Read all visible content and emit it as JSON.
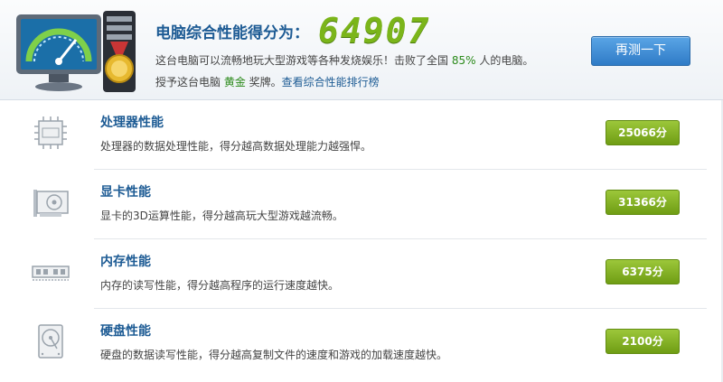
{
  "header": {
    "score_label": "电脑综合性能得分为：",
    "score_value": "64907",
    "desc_part1": "这台电脑可以流畅地玩大型游戏等各种发烧娱乐！击败了全国 ",
    "beat_percent": "85%",
    "desc_part2": " 人的电脑。",
    "award_part1": "授予这台电脑 ",
    "medal": "黄金",
    "award_part2": " 奖牌。",
    "rank_link": "查看综合性能排行榜",
    "retest_label": "再测一下",
    "icons": [
      "performance-meter-monitor-icon",
      "gold-medal-pc-tower-icon"
    ]
  },
  "components": [
    {
      "title": "处理器性能",
      "desc": "处理器的数据处理性能，得分越高数据处理能力越强悍。",
      "score": "25066分",
      "icon": "cpu-icon"
    },
    {
      "title": "显卡性能",
      "desc": "显卡的3D运算性能，得分越高玩大型游戏越流畅。",
      "score": "31366分",
      "icon": "graphics-card-icon"
    },
    {
      "title": "内存性能",
      "desc": "内存的读写性能，得分越高程序的运行速度越快。",
      "score": "6375分",
      "icon": "memory-icon"
    },
    {
      "title": "硬盘性能",
      "desc": "硬盘的数据读写性能，得分越高复制文件的速度和游戏的加载速度越快。",
      "score": "2100分",
      "icon": "hard-disk-icon"
    }
  ],
  "colors": {
    "accent_blue": "#1d5b94",
    "score_green": "#7bb51a",
    "badge_green": "#85b225",
    "button_blue": "#3d8ad4"
  }
}
